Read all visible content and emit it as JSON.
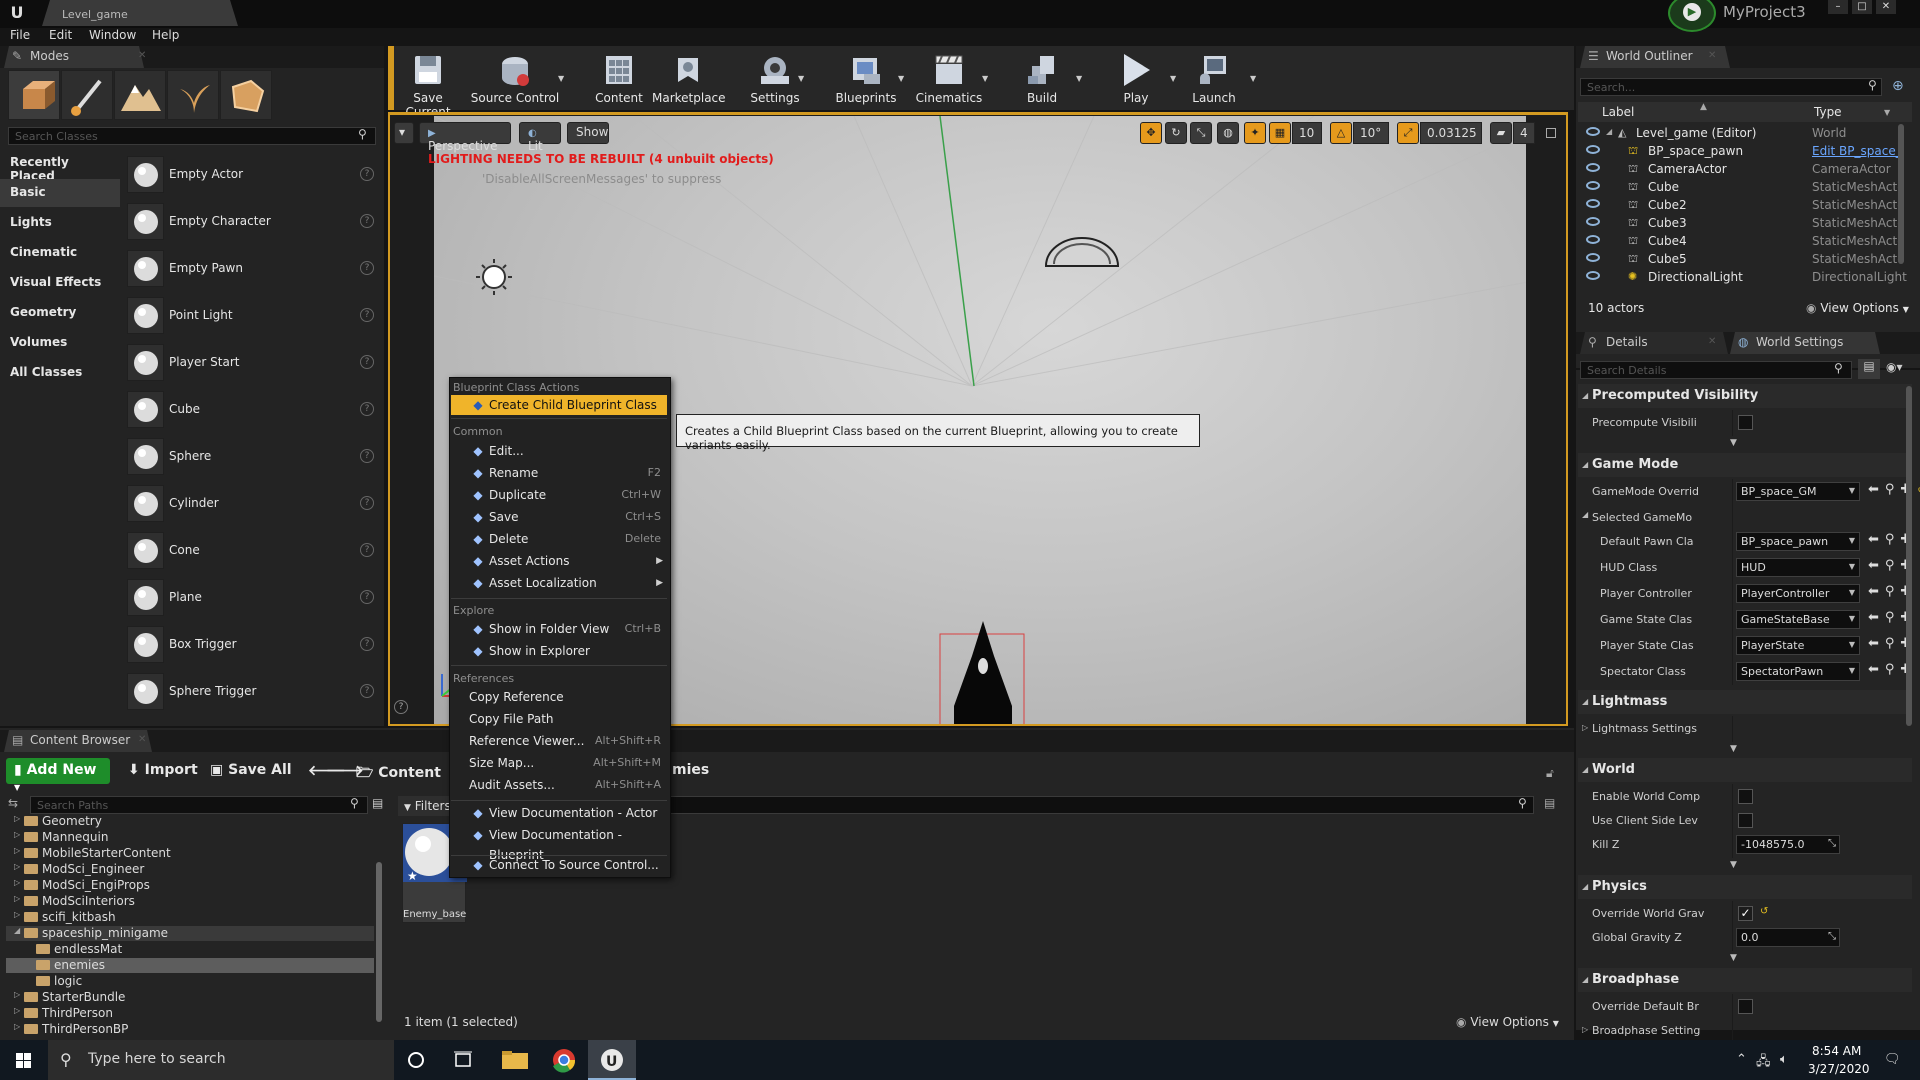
{
  "window": {
    "doc_tab": "Level_game",
    "project": "MyProject3",
    "min": "–",
    "max": "□",
    "close": "✕"
  },
  "menu": [
    "File",
    "Edit",
    "Window",
    "Help"
  ],
  "modes": {
    "tab": "Modes",
    "search_placeholder": "Search Classes",
    "categories": [
      "Recently Placed",
      "Basic",
      "Lights",
      "Cinematic",
      "Visual Effects",
      "Geometry",
      "Volumes",
      "All Classes"
    ],
    "active_category": "Basic",
    "actors": [
      "Empty Actor",
      "Empty Character",
      "Empty Pawn",
      "Point Light",
      "Player Start",
      "Cube",
      "Sphere",
      "Cylinder",
      "Cone",
      "Plane",
      "Box Trigger",
      "Sphere Trigger"
    ]
  },
  "toolbar": {
    "buttons": [
      "Save Current",
      "Source Control",
      "Content",
      "Marketplace",
      "Settings",
      "Blueprints",
      "Cinematics",
      "Build",
      "Play",
      "Launch"
    ]
  },
  "viewport": {
    "perspective": "Perspective",
    "lit": "Lit",
    "show": "Show",
    "grid_snap": "10",
    "rot_snap": "10°",
    "scale_snap": "0.03125",
    "cam_speed": "4",
    "warning": "LIGHTING NEEDS TO BE REBUILT (4 unbuilt objects)",
    "suppress": "'DisableAllScreenMessages' to suppress"
  },
  "context_menu": {
    "sections": {
      "blueprint": "Blueprint Class Actions",
      "common": "Common",
      "explore": "Explore",
      "references": "References"
    },
    "create_child": "Create Child Blueprint Class",
    "common_items": [
      {
        "label": "Edit...",
        "key": ""
      },
      {
        "label": "Rename",
        "key": "F2"
      },
      {
        "label": "Duplicate",
        "key": "Ctrl+W"
      },
      {
        "label": "Save",
        "key": "Ctrl+S"
      },
      {
        "label": "Delete",
        "key": "Delete"
      },
      {
        "label": "Asset Actions",
        "key": ""
      },
      {
        "label": "Asset Localization",
        "key": ""
      }
    ],
    "explore_items": [
      {
        "label": "Show in Folder View",
        "key": "Ctrl+B"
      },
      {
        "label": "Show in Explorer",
        "key": ""
      }
    ],
    "reference_items": [
      {
        "label": "Copy Reference",
        "key": ""
      },
      {
        "label": "Copy File Path",
        "key": ""
      },
      {
        "label": "Reference Viewer...",
        "key": "Alt+Shift+R"
      },
      {
        "label": "Size Map...",
        "key": "Alt+Shift+M"
      },
      {
        "label": "Audit Assets...",
        "key": "Alt+Shift+A"
      }
    ],
    "doc_items": [
      "View Documentation - Actor",
      "View Documentation - Blueprint"
    ],
    "source_control": "Connect To Source Control..."
  },
  "tooltip": "Creates a Child Blueprint Class based on the current Blueprint, allowing you to create variants easily.",
  "outliner": {
    "tab": "World Outliner",
    "search_placeholder": "Search...",
    "col_label": "Label",
    "col_type": "Type",
    "rows": [
      {
        "name": "Level_game (Editor)",
        "type": "World"
      },
      {
        "name": "BP_space_pawn",
        "type": "Edit BP_space_"
      },
      {
        "name": "CameraActor",
        "type": "CameraActor"
      },
      {
        "name": "Cube",
        "type": "StaticMeshActo"
      },
      {
        "name": "Cube2",
        "type": "StaticMeshActo"
      },
      {
        "name": "Cube3",
        "type": "StaticMeshActo"
      },
      {
        "name": "Cube4",
        "type": "StaticMeshActo"
      },
      {
        "name": "Cube5",
        "type": "StaticMeshActo"
      },
      {
        "name": "DirectionalLight",
        "type": "DirectionalLight"
      }
    ],
    "count": "10 actors",
    "view_options": "View Options"
  },
  "details": {
    "tab_details": "Details",
    "tab_world": "World Settings",
    "search_placeholder": "Search Details",
    "sections": {
      "precomputed": "Precomputed Visibility",
      "gamemode": "Game Mode",
      "lightmass": "Lightmass",
      "world": "World",
      "physics": "Physics",
      "broadphase": "Broadphase"
    },
    "precompute_label": "Precompute Visibili",
    "gamemode_override_label": "GameMode Overrid",
    "gamemode_override_value": "BP_space_GM",
    "selected_gamemode": "Selected GameMo",
    "gm_rows": [
      {
        "label": "Default Pawn Cla",
        "value": "BP_space_pawn"
      },
      {
        "label": "HUD Class",
        "value": "HUD"
      },
      {
        "label": "Player Controller",
        "value": "PlayerController"
      },
      {
        "label": "Game State Clas",
        "value": "GameStateBase"
      },
      {
        "label": "Player State Clas",
        "value": "PlayerState"
      },
      {
        "label": "Spectator Class",
        "value": "SpectatorPawn"
      }
    ],
    "lightmass_settings": "Lightmass Settings",
    "enable_world_comp": "Enable World Comp",
    "use_client_side": "Use Client Side Lev",
    "kill_z_label": "Kill Z",
    "kill_z_value": "-1048575.0",
    "override_gravity": "Override World Grav",
    "global_gravity_label": "Global Gravity Z",
    "global_gravity_value": "0.0",
    "override_broadphase": "Override Default Br",
    "broadphase_settings": "Broadphase Setting"
  },
  "content_browser": {
    "tab": "Content Browser",
    "add_new": "Add New",
    "import": "Import",
    "save_all": "Save All",
    "path_content": "Content",
    "path_tail": "mies",
    "search_paths": "Search Paths",
    "filters": "Filters",
    "folders": [
      "Geometry",
      "Mannequin",
      "MobileStarterContent",
      "ModSci_Engineer",
      "ModSci_EngiProps",
      "ModSciInteriors",
      "scifi_kitbash",
      "spaceship_minigame",
      "endlessMat",
      "enemies",
      "logic",
      "StarterBundle",
      "ThirdPerson",
      "ThirdPersonBP"
    ],
    "asset_name": "Enemy_base",
    "status": "1 item (1 selected)",
    "view_options": "View Options"
  },
  "taskbar": {
    "search": "Type here to search",
    "time": "8:54 AM",
    "date": "3/27/2020"
  },
  "colors": {
    "accent": "#f0b42a",
    "add_new": "#1e8d2a",
    "warning": "#e11c1c"
  }
}
